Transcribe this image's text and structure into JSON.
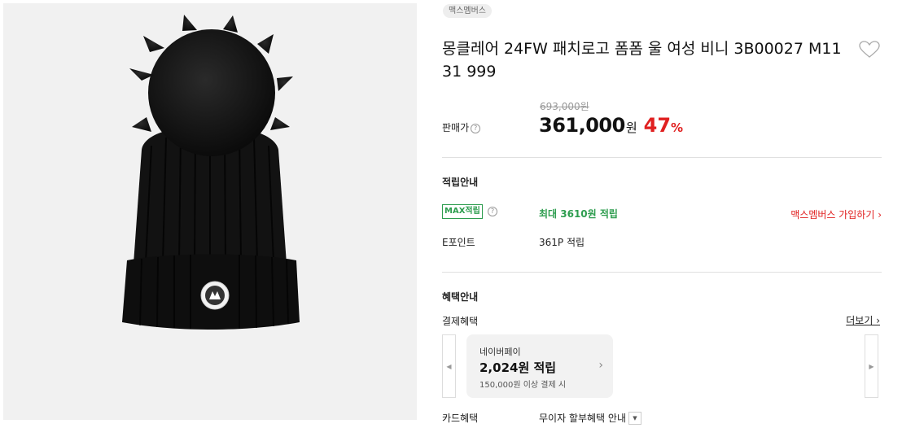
{
  "product": {
    "member_tag": "맥스멤버스",
    "title": "몽클레어 24FW 패치로고 폼폼 울 여성 비니 3B00027 M1131 999",
    "image_alt": "Black ribbed knit beanie with black fur pompom and Moncler logo patch"
  },
  "pricing": {
    "label": "판매가",
    "help": "?",
    "original_price": "693,000원",
    "sale_price": "361,000",
    "currency_unit": "원",
    "discount_rate": "47",
    "discount_unit": "%"
  },
  "rewards": {
    "heading": "적립안내",
    "max_badge": "MAX적립",
    "max_help": "?",
    "max_text": "최대 3610원 적립",
    "signup_link": "맥스멤버스 가입하기 ›",
    "epoint_label": "E포인트",
    "epoint_value": "361P 적립"
  },
  "benefits": {
    "heading": "혜택안내",
    "payment_label": "결제혜택",
    "more_link": "더보기 ›",
    "prev_arrow": "◀",
    "next_arrow": "▶",
    "card": {
      "provider": "네이버페이",
      "amount": "2,024원 적립",
      "condition": "150,000원 이상 결제 시",
      "chevron": "›"
    },
    "card_benefit_label": "카드혜택",
    "card_benefit_value": "무이자 할부혜택 안내",
    "select_arrow": "▼"
  },
  "icons": {
    "wish": "heart-outline-icon",
    "colors": {
      "accent_red": "#e02020",
      "reward_green": "#2e9d4f"
    }
  }
}
